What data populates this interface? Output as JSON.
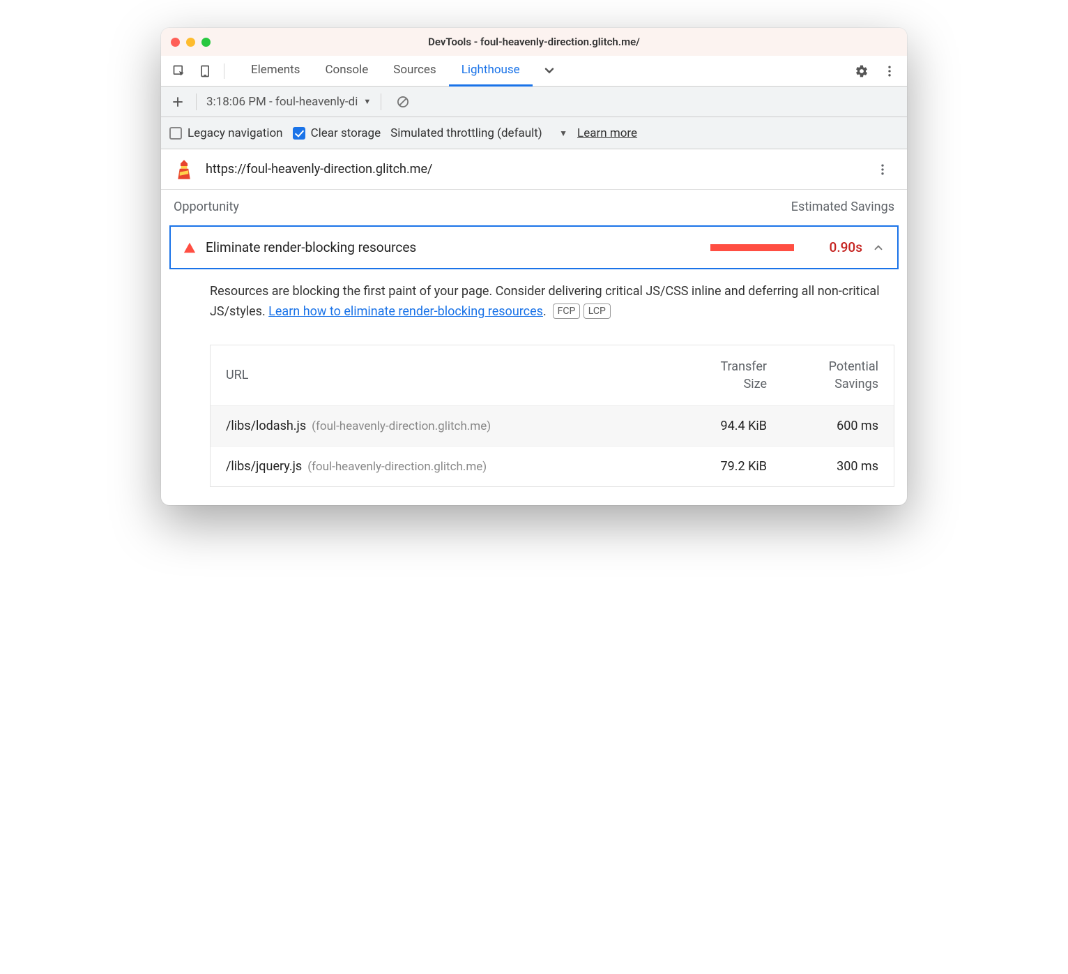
{
  "titlebar": {
    "title": "DevTools - foul-heavenly-direction.glitch.me/"
  },
  "tabs": {
    "items": [
      "Elements",
      "Console",
      "Sources",
      "Lighthouse"
    ],
    "activeIndex": 3
  },
  "subtoolbar": {
    "report_label": "3:18:06 PM - foul-heavenly-di"
  },
  "options": {
    "legacy_label": "Legacy navigation",
    "legacy_checked": false,
    "clear_label": "Clear storage",
    "clear_checked": true,
    "throttling_label": "Simulated throttling (default)",
    "learn_more": "Learn more"
  },
  "report": {
    "url": "https://foul-heavenly-direction.glitch.me/",
    "opportunity_header": "Opportunity",
    "savings_header": "Estimated Savings"
  },
  "audit": {
    "title": "Eliminate render-blocking resources",
    "savings": "0.90s",
    "description_pre": "Resources are blocking the first paint of your page. Consider delivering critical JS/CSS inline and deferring all non-critical JS/styles. ",
    "link_text": "Learn how to eliminate render-blocking resources",
    "description_post": ".",
    "badges": [
      "FCP",
      "LCP"
    ],
    "table": {
      "headers": {
        "url": "URL",
        "size1": "Transfer",
        "size2": "Size",
        "sav1": "Potential",
        "sav2": "Savings"
      },
      "rows": [
        {
          "path": "/libs/lodash.js",
          "host": "(foul-heavenly-direction.glitch.me)",
          "size": "94.4 KiB",
          "savings": "600 ms"
        },
        {
          "path": "/libs/jquery.js",
          "host": "(foul-heavenly-direction.glitch.me)",
          "size": "79.2 KiB",
          "savings": "300 ms"
        }
      ]
    }
  }
}
